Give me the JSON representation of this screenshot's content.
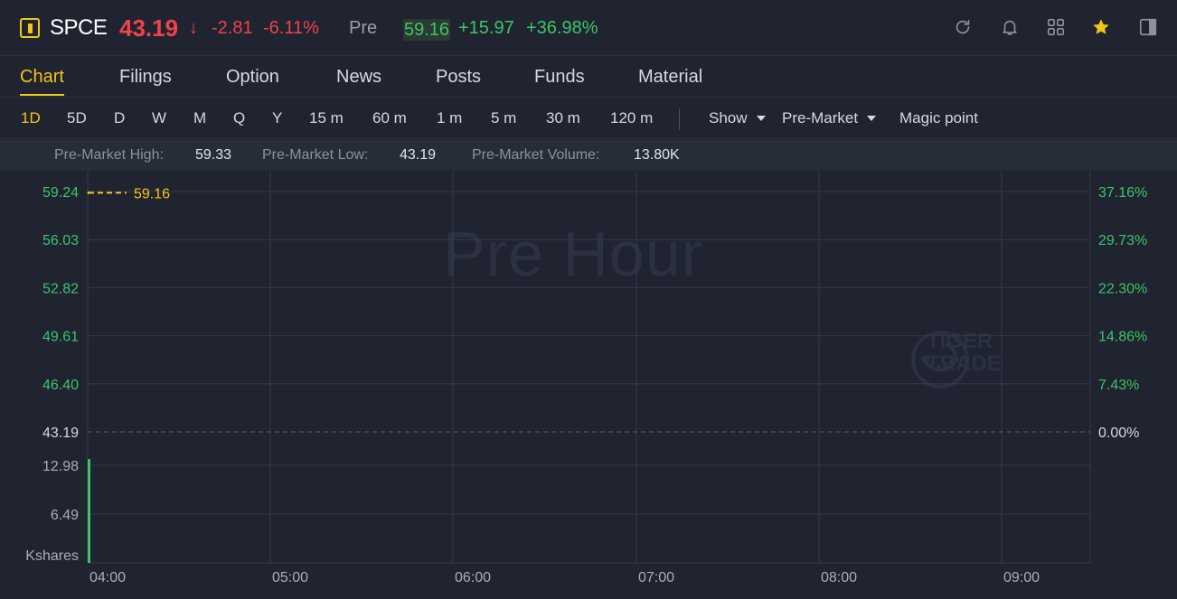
{
  "header": {
    "symbol": "SPCE",
    "price": "43.19",
    "arrow": "↓",
    "change": "-2.81",
    "change_pct": "-6.11%",
    "pre_label": "Pre",
    "pre_price": "59.16",
    "pre_change": "+15.97",
    "pre_change_pct": "+36.98%",
    "icons": [
      "refresh-icon",
      "bell-icon",
      "grid-icon",
      "star-icon",
      "panel-icon"
    ]
  },
  "tabs": [
    {
      "label": "Chart",
      "active": true
    },
    {
      "label": "Filings"
    },
    {
      "label": "Option"
    },
    {
      "label": "News"
    },
    {
      "label": "Posts"
    },
    {
      "label": "Funds"
    },
    {
      "label": "Material"
    }
  ],
  "periods": [
    "1D",
    "5D",
    "D",
    "W",
    "M",
    "Q",
    "Y",
    "15 m",
    "60 m",
    "1 m",
    "5 m",
    "30 m",
    "120 m"
  ],
  "active_period": "1D",
  "controls": {
    "show_label": "Show",
    "premarket_label": "Pre-Market",
    "magic_label": "Magic point"
  },
  "stats": {
    "high_label": "Pre-Market High:",
    "high_value": "59.33",
    "low_label": "Pre-Market Low:",
    "low_value": "43.19",
    "volume_label": "Pre-Market Volume:",
    "volume_value": "13.80K"
  },
  "chart": {
    "watermark": "Pre Hour",
    "logo_line1": "TIGER",
    "logo_line2": "TRADE",
    "current_price_label": "59.16",
    "price_ticks": [
      "59.24",
      "56.03",
      "52.82",
      "49.61",
      "46.40",
      "43.19"
    ],
    "pct_ticks": [
      "37.16%",
      "29.73%",
      "22.30%",
      "14.86%",
      "7.43%",
      "0.00%"
    ],
    "volume_ticks": [
      "12.98",
      "6.49"
    ],
    "volume_unit": "Kshares",
    "time_ticks": [
      "04:00",
      "05:00",
      "06:00",
      "07:00",
      "08:00",
      "09:00"
    ],
    "colors": {
      "up": "#3cc46b",
      "down": "#f0424c",
      "accent": "#f5c518",
      "grid": "#343a47"
    }
  },
  "chart_data": {
    "type": "line",
    "x": [
      "04:00"
    ],
    "y": [
      59.16
    ],
    "volume_x": [
      "04:00"
    ],
    "volume": [
      13.8
    ],
    "price_ylim": [
      43.19,
      59.24
    ],
    "pct_ylim": [
      0.0,
      37.16
    ],
    "volume_ylim": [
      0,
      12.98
    ],
    "x_ticks": [
      "04:00",
      "05:00",
      "06:00",
      "07:00",
      "08:00",
      "09:00"
    ],
    "reference_price": 43.19,
    "grid": true
  }
}
